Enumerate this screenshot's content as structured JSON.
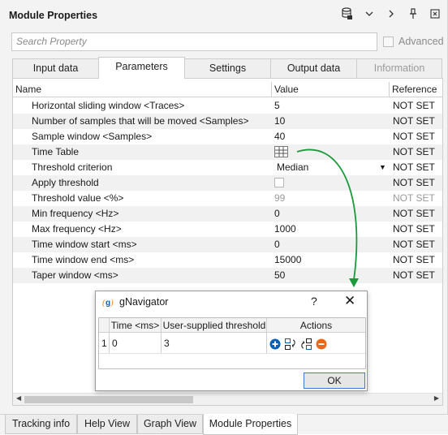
{
  "panel": {
    "title": "Module Properties",
    "icons": [
      "database-lock-icon",
      "chevron-down-icon",
      "chevron-right-icon",
      "pin-icon",
      "close-icon"
    ]
  },
  "search": {
    "placeholder": "Search Property",
    "advanced_label": "Advanced"
  },
  "tabs": [
    {
      "label": "Input data",
      "active": false,
      "enabled": true
    },
    {
      "label": "Parameters",
      "active": true,
      "enabled": true
    },
    {
      "label": "Settings",
      "active": false,
      "enabled": true
    },
    {
      "label": "Output data",
      "active": false,
      "enabled": true
    },
    {
      "label": "Information",
      "active": false,
      "enabled": false
    }
  ],
  "table": {
    "columns": [
      "Name",
      "Value",
      "Reference"
    ],
    "rows": [
      {
        "name": "Horizontal sliding window <Traces>",
        "value": "5",
        "reference": "NOT SET"
      },
      {
        "name": "Number of samples that will be moved <Samples>",
        "value": "10",
        "reference": "NOT SET"
      },
      {
        "name": "Sample window <Samples>",
        "value": "40",
        "reference": "NOT SET"
      },
      {
        "name": "Time Table",
        "value": "",
        "reference": "NOT SET"
      },
      {
        "name": "Threshold criterion",
        "value": "Median",
        "reference": "NOT SET"
      },
      {
        "name": "Apply threshold",
        "value": "",
        "reference": "NOT SET"
      },
      {
        "name": "Threshold value <%>",
        "value": "99",
        "reference": "NOT SET"
      },
      {
        "name": "Min frequency <Hz>",
        "value": "0",
        "reference": "NOT SET"
      },
      {
        "name": "Max frequency <Hz>",
        "value": "1000",
        "reference": "NOT SET"
      },
      {
        "name": "Time window start <ms>",
        "value": "0",
        "reference": "NOT SET"
      },
      {
        "name": "Time window end <ms>",
        "value": "15000",
        "reference": "NOT SET"
      },
      {
        "name": "Taper window <ms>",
        "value": "50",
        "reference": "NOT SET"
      }
    ]
  },
  "dialog": {
    "title": "gNavigator",
    "help": "?",
    "close": "✕",
    "columns": [
      "Time <ms>",
      "User-supplied threshold",
      "Actions"
    ],
    "row": {
      "index": "1",
      "time": "0",
      "threshold": "3"
    },
    "ok_label": "OK"
  },
  "bottom_tabs": [
    {
      "label": "Tracking info",
      "active": false
    },
    {
      "label": "Help View",
      "active": false
    },
    {
      "label": "Graph View",
      "active": false
    },
    {
      "label": "Module Properties",
      "active": true
    }
  ],
  "colors": {
    "arrow": "#1a9a3a",
    "accent": "#0a5fb4",
    "remove": "#e8671a"
  }
}
